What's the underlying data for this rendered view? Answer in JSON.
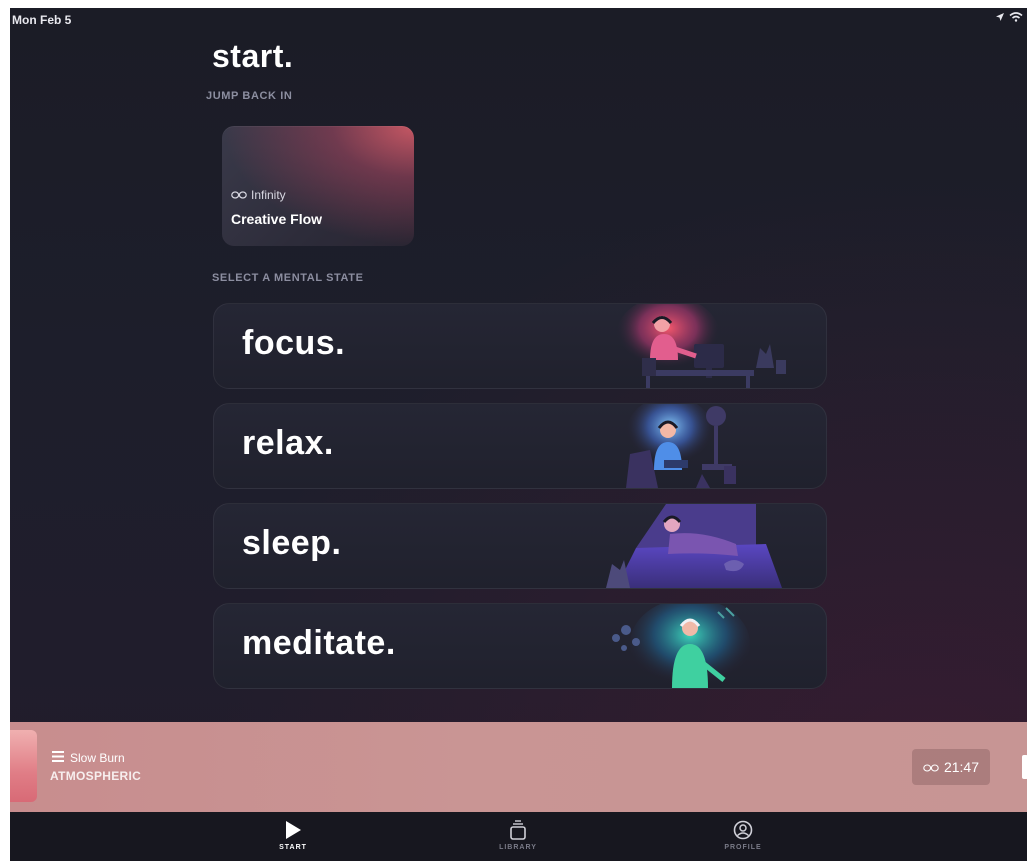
{
  "status_bar": {
    "date": "Mon Feb 5"
  },
  "page": {
    "title": "start.",
    "jump_back_label": "JUMP BACK IN",
    "select_label": "SELECT A MENTAL STATE"
  },
  "recent": {
    "type": "Infinity",
    "name": "Creative Flow"
  },
  "mental_states": [
    {
      "label": "focus.",
      "accent": "#e04a6a"
    },
    {
      "label": "relax.",
      "accent": "#4aa8ff"
    },
    {
      "label": "sleep.",
      "accent": "#6d4fd6"
    },
    {
      "label": "meditate.",
      "accent": "#2fd0a0"
    }
  ],
  "player": {
    "track": "Slow Burn",
    "genre": "ATMOSPHERIC",
    "timer": "21:47"
  },
  "tabs": [
    {
      "label": "START",
      "icon": "play-icon",
      "active": true
    },
    {
      "label": "LIBRARY",
      "icon": "library-icon",
      "active": false
    },
    {
      "label": "PROFILE",
      "icon": "profile-icon",
      "active": false
    }
  ]
}
